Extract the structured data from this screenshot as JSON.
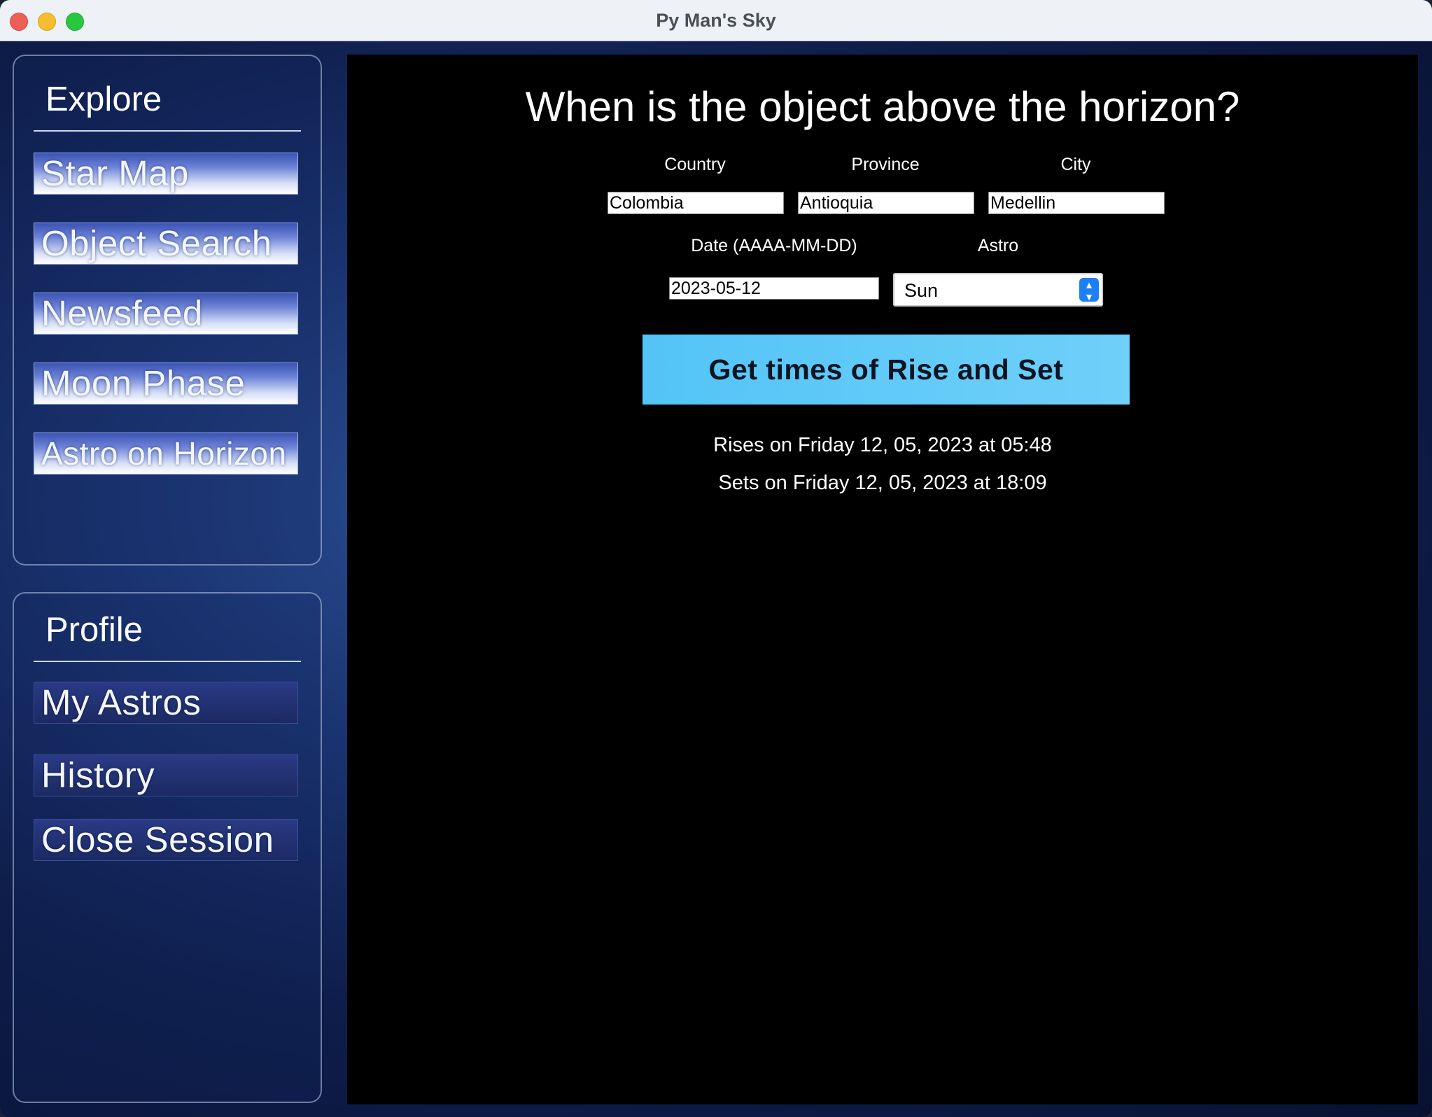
{
  "window": {
    "title": "Py Man's Sky"
  },
  "sidebar": {
    "explore": {
      "heading": "Explore",
      "items": [
        {
          "label": "Star Map"
        },
        {
          "label": "Object Search"
        },
        {
          "label": "Newsfeed"
        },
        {
          "label": "Moon Phase"
        },
        {
          "label": "Astro on Horizon"
        }
      ]
    },
    "profile": {
      "heading": "Profile",
      "items": [
        {
          "label": "My Astros"
        },
        {
          "label": "History"
        },
        {
          "label": "Close Session"
        }
      ]
    }
  },
  "main": {
    "title": "When is the object above the horizon?",
    "country": {
      "label": "Country",
      "value": "Colombia"
    },
    "province": {
      "label": "Province",
      "value": "Antioquia"
    },
    "city": {
      "label": "City",
      "value": "Medellin"
    },
    "date": {
      "label": "Date (AAAA-MM-DD)",
      "value": "2023-05-12"
    },
    "astro": {
      "label": "Astro",
      "selected": "Sun"
    },
    "button_label": "Get times of Rise and Set",
    "rise_text": "Rises on Friday 12, 05, 2023 at 05:48",
    "set_text": "Sets on Friday 12, 05, 2023 at 18:09"
  },
  "colors": {
    "button_bg": "#5bcaf8",
    "content_bg": "#000000",
    "sidebar_bg": "#13275f"
  }
}
